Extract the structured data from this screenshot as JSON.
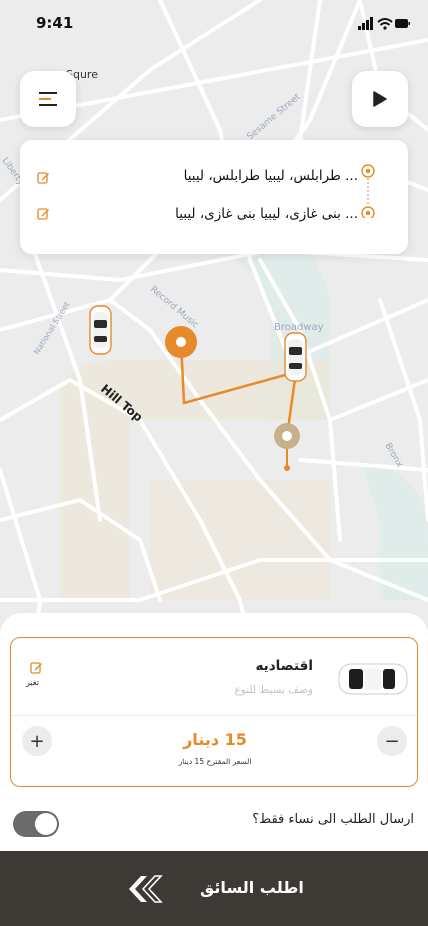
{
  "status_bar": {
    "time": "9:41"
  },
  "map": {
    "labels": {
      "top_street": "Squre",
      "sesame": "Sesame Street",
      "liberty": "Liberty",
      "record_music": "Record Music",
      "broadway": "Broadway",
      "national": "National Street",
      "hill_top": "Hill Top",
      "bronx": "Bronx"
    }
  },
  "route": {
    "pickup": "... طرابلس، ليبيا طرابلس، ليبيا",
    "dropoff": "... بنى غازى، ليبيا بنى غازى، ليبيا"
  },
  "ride_option": {
    "name": "اقتصاديه",
    "description": "وصف بسيط للنوع",
    "change_label": "تغير"
  },
  "price": {
    "amount": "15 دينار",
    "suggested": "السعر المقترح 15 دينار",
    "plus": "+",
    "minus": "−"
  },
  "women_only": {
    "label": "ارسال الطلب الى نساء فقط؟",
    "enabled": true
  },
  "cta": {
    "label": "اطلب السائق"
  },
  "colors": {
    "accent": "#e8892a",
    "cta_bg": "#3d3935",
    "map_bg": "#ececec"
  }
}
